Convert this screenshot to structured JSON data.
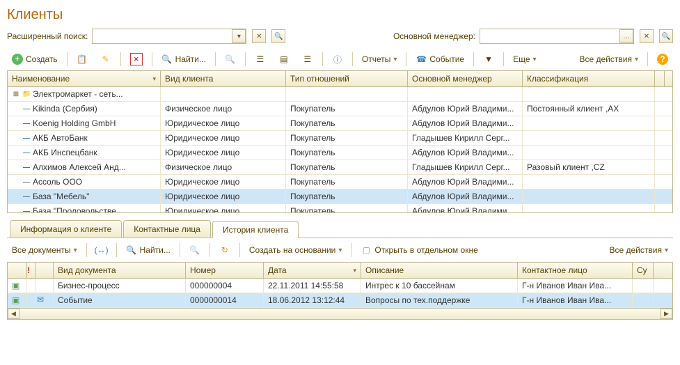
{
  "title": "Клиенты",
  "search": {
    "label": "Расширенный поиск:",
    "value": ""
  },
  "manager_filter": {
    "label": "Основной менеджер:",
    "value": ""
  },
  "toolbar": {
    "create": "Создать",
    "find": "Найти...",
    "reports": "Отчеты",
    "event": "Событие",
    "more": "Еще",
    "all_actions": "Все действия"
  },
  "grid": {
    "headers": {
      "name": "Наименование",
      "kind": "Вид клиента",
      "relation": "Тип отношений",
      "manager": "Основной менеджер",
      "classification": "Классификация"
    },
    "rows": [
      {
        "icon": "folder",
        "name": "Электромаркет - сеть...",
        "kind": "",
        "relation": "",
        "manager": "",
        "class": ""
      },
      {
        "icon": "item",
        "name": "Kikinda (Сербия)",
        "kind": "Физическое лицо",
        "relation": "Покупатель",
        "manager": "Абдулов Юрий Владими...",
        "class": "Постоянный клиент ,AX"
      },
      {
        "icon": "item",
        "name": "Koenig Holding GmbH",
        "kind": "Юридическое лицо",
        "relation": "Покупатель",
        "manager": "Абдулов Юрий Владими...",
        "class": ""
      },
      {
        "icon": "item",
        "name": "АКБ АвтоБанк",
        "kind": "Юридическое лицо",
        "relation": "Покупатель",
        "manager": "Гладышев Кирилл Серг...",
        "class": ""
      },
      {
        "icon": "item",
        "name": "АКБ Инспецбанк",
        "kind": "Юридическое лицо",
        "relation": "Покупатель",
        "manager": "Абдулов Юрий Владими...",
        "class": ""
      },
      {
        "icon": "item",
        "name": "Алхимов Алексей Анд...",
        "kind": "Физическое лицо",
        "relation": "Покупатель",
        "manager": "Гладышев Кирилл Серг...",
        "class": "Разовый клиент ,CZ"
      },
      {
        "icon": "item",
        "name": "Ассоль ООО",
        "kind": "Юридическое лицо",
        "relation": "Покупатель",
        "manager": "Абдулов Юрий Владими...",
        "class": ""
      },
      {
        "icon": "item",
        "name": "База \"Мебель\"",
        "kind": "Юридическое лицо",
        "relation": "Покупатель",
        "manager": "Абдулов Юрий Владими...",
        "class": "",
        "selected": true
      },
      {
        "icon": "item",
        "name": "База \"Продовольстве...",
        "kind": "Юридическое лицо",
        "relation": "Покупатель",
        "manager": "Абдулов Юрий Владими...",
        "class": ""
      }
    ]
  },
  "tabs": {
    "info": "Информация о клиенте",
    "contacts": "Контактные лица",
    "history": "История клиента"
  },
  "sub_toolbar": {
    "all_docs": "Все документы",
    "find": "Найти...",
    "create_based": "Создать на основании",
    "open_window": "Открыть в отдельном окне",
    "all_actions": "Все действия"
  },
  "detail": {
    "headers": {
      "flag": "!",
      "doctype": "Вид документа",
      "number": "Номер",
      "date": "Дата",
      "desc": "Описание",
      "contact": "Контактное лицо",
      "su": "Су"
    },
    "rows": [
      {
        "doctype": "Бизнес-процесс",
        "number": "000000004",
        "date": "22.11.2011 14:55:58",
        "desc": "Интрес к 10 бассейнам",
        "contact": "Г-н Иванов Иван Ива..."
      },
      {
        "doctype": "Событие",
        "number": "0000000014",
        "date": "18.06.2012 13:12:44",
        "desc": "Вопросы по тех.поддержке",
        "contact": "Г-н Иванов Иван Ива...",
        "selected": true,
        "icon": true
      }
    ]
  }
}
